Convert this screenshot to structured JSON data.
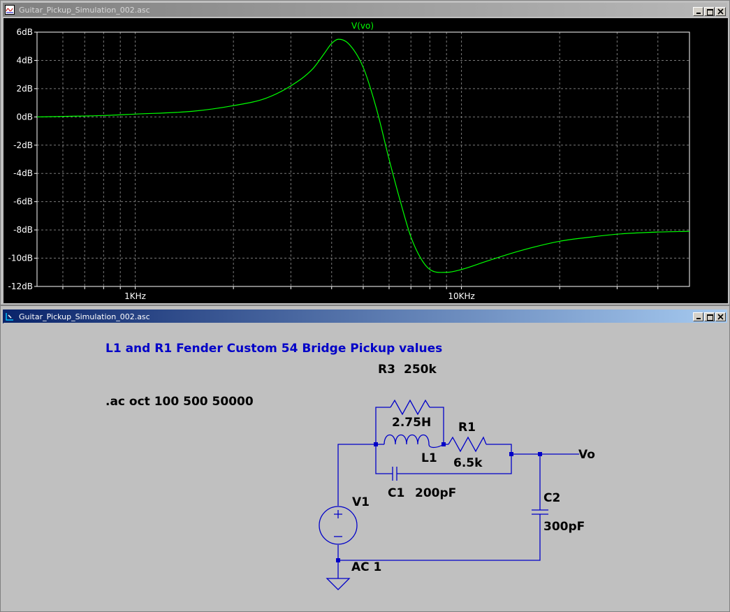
{
  "plot_window": {
    "title": "Guitar_Pickup_Simulation_002.asc",
    "icon": "waveform-icon",
    "trace_label": "V(vo)",
    "trace_color": "#00ff00",
    "chart_data": {
      "type": "line",
      "title": "",
      "xlabel": "",
      "ylabel": "",
      "x_scale": "log",
      "xlim": [
        500,
        50000
      ],
      "ylim": [
        -12,
        6
      ],
      "grid": true,
      "y_ticks": [
        "6dB",
        "4dB",
        "2dB",
        "0dB",
        "-2dB",
        "-4dB",
        "-6dB",
        "-8dB",
        "-10dB",
        "-12dB"
      ],
      "x_ticks": [
        "1KHz",
        "10KHz"
      ],
      "series": [
        {
          "name": "V(vo)",
          "x": [
            500,
            800,
            1000,
            1500,
            2000,
            2500,
            3000,
            3500,
            3800,
            4000,
            4200,
            4500,
            5000,
            5500,
            6000,
            6500,
            7000,
            7500,
            8000,
            9000,
            10000,
            12000,
            15000,
            20000,
            25000,
            30000,
            40000,
            50000
          ],
          "y": [
            0.0,
            0.1,
            0.2,
            0.4,
            0.8,
            1.3,
            2.2,
            3.4,
            4.5,
            5.2,
            5.5,
            5.2,
            3.5,
            0.5,
            -3.0,
            -6.0,
            -8.5,
            -10.0,
            -10.8,
            -11.0,
            -10.8,
            -10.2,
            -9.5,
            -8.8,
            -8.5,
            -8.3,
            -8.15,
            -8.1
          ]
        }
      ]
    }
  },
  "schematic_window": {
    "title": "Guitar_Pickup_Simulation_002.asc",
    "icon": "schematic-icon",
    "comment": "L1 and R1 Fender Custom 54 Bridge Pickup values",
    "directive": ".ac oct 100 500 50000",
    "components": {
      "r3_name": "R3",
      "r3_value": "250k",
      "l1_value": "2.75H",
      "l1_name": "L1",
      "r1_name": "R1",
      "r1_value": "6.5k",
      "c1_name": "C1",
      "c1_value": "200pF",
      "c2_name": "C2",
      "c2_value": "300pF",
      "v1_name": "V1",
      "v1_value": "AC 1",
      "net_label": "Vo"
    },
    "colors": {
      "wire": "#0000c8",
      "label": "#000000",
      "comment": "#0000c8"
    }
  }
}
